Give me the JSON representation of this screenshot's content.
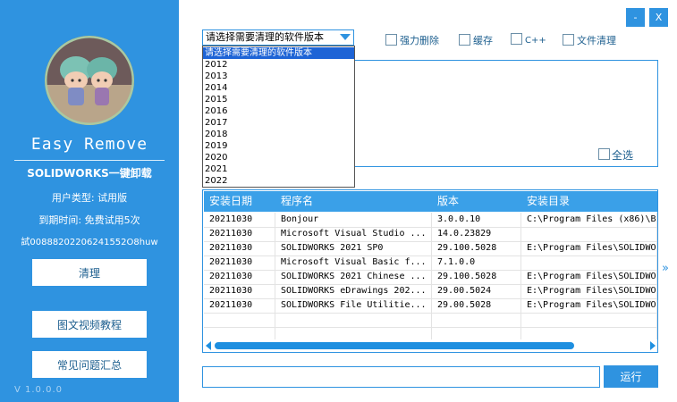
{
  "sidebar": {
    "app_title": "Easy Remove",
    "subtitle": "SOLIDWORKS一键卸载",
    "user_type": "用户类型: 试用版",
    "expiry": "到期时间: 免费试用5次",
    "serial": "試00888202206241552O8huw",
    "buttons": {
      "clean": "清理",
      "tutorial": "图文视频教程",
      "faq": "常见问题汇总"
    },
    "version": "V 1.0.0.0",
    "background_color": "#2f93e0"
  },
  "window": {
    "minimize_label": "-",
    "close_label": "X"
  },
  "version_select": {
    "selected": "请选择需要清理的软件版本",
    "options": [
      "请选择需要清理的软件版本",
      "2012",
      "2013",
      "2014",
      "2015",
      "2016",
      "2017",
      "2018",
      "2019",
      "2020",
      "2021",
      "2022"
    ]
  },
  "options": {
    "force_delete": "强力删除",
    "cache": "缓存",
    "cpp": "C++",
    "file_cleanup": "文件清理",
    "select_all": "全选"
  },
  "table": {
    "columns": [
      "安装日期",
      "程序名",
      "版本",
      "安装目录"
    ],
    "rows": [
      [
        "20211030",
        "Bonjour",
        "3.0.0.10",
        "C:\\Program Files (x86)\\B"
      ],
      [
        "20211030",
        "Microsoft Visual Studio ...",
        "14.0.23829",
        ""
      ],
      [
        "20211030",
        "SOLIDWORKS 2021 SP0",
        "29.100.5028",
        "E:\\Program Files\\SOLIDWO"
      ],
      [
        "20211030",
        "Microsoft Visual Basic f...",
        "7.1.0.0",
        ""
      ],
      [
        "20211030",
        "SOLIDWORKS 2021 Chinese ...",
        "29.100.5028",
        "E:\\Program Files\\SOLIDWO"
      ],
      [
        "20211030",
        "SOLIDWORKS eDrawings 202...",
        "29.00.5024",
        "E:\\Program Files\\SOLIDWO"
      ],
      [
        "20211030",
        "SOLIDWORKS File Utilitie...",
        "29.00.5028",
        "E:\\Program Files\\SOLIDWO"
      ]
    ],
    "horizontal_scroll_fraction": 0.8
  },
  "run_label": "运行",
  "colors": {
    "accent": "#2f93e0",
    "header": "#3aa0e8",
    "selection": "#1e64d6"
  }
}
